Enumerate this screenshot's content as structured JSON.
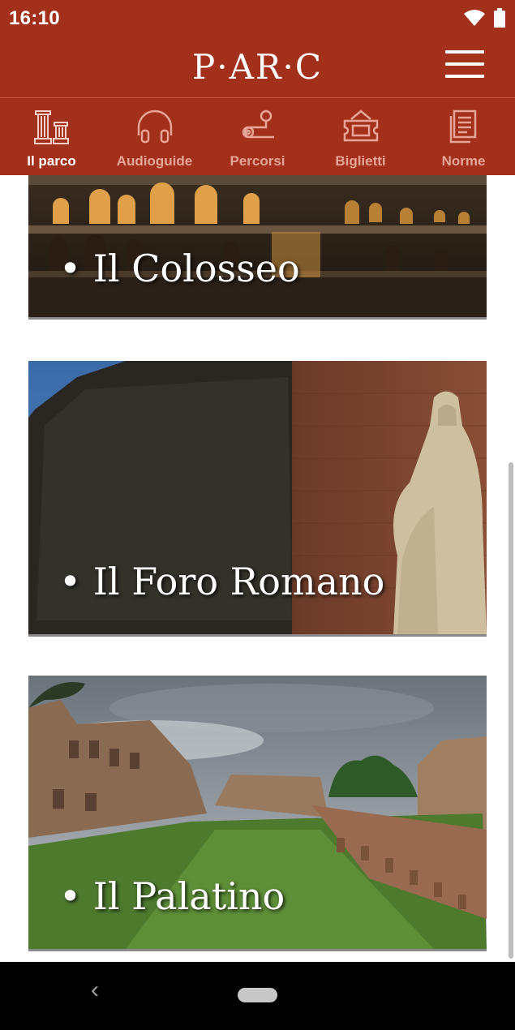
{
  "status": {
    "time": "16:10"
  },
  "header": {
    "logo": "P·AR·C"
  },
  "tabs": [
    {
      "label": "Il parco",
      "icon": "columns-icon",
      "active": true
    },
    {
      "label": "Audioguide",
      "icon": "headphones-icon",
      "active": false
    },
    {
      "label": "Percorsi",
      "icon": "route-icon",
      "active": false
    },
    {
      "label": "Biglietti",
      "icon": "ticket-icon",
      "active": false
    },
    {
      "label": "Norme",
      "icon": "rules-document-icon",
      "active": false
    }
  ],
  "cards": [
    {
      "title": "• Il Colosseo"
    },
    {
      "title": "• Il Foro Romano"
    },
    {
      "title": "• Il Palatino"
    }
  ],
  "colors": {
    "primary": "#a3301b",
    "inactive_tab": "#e6a597"
  }
}
